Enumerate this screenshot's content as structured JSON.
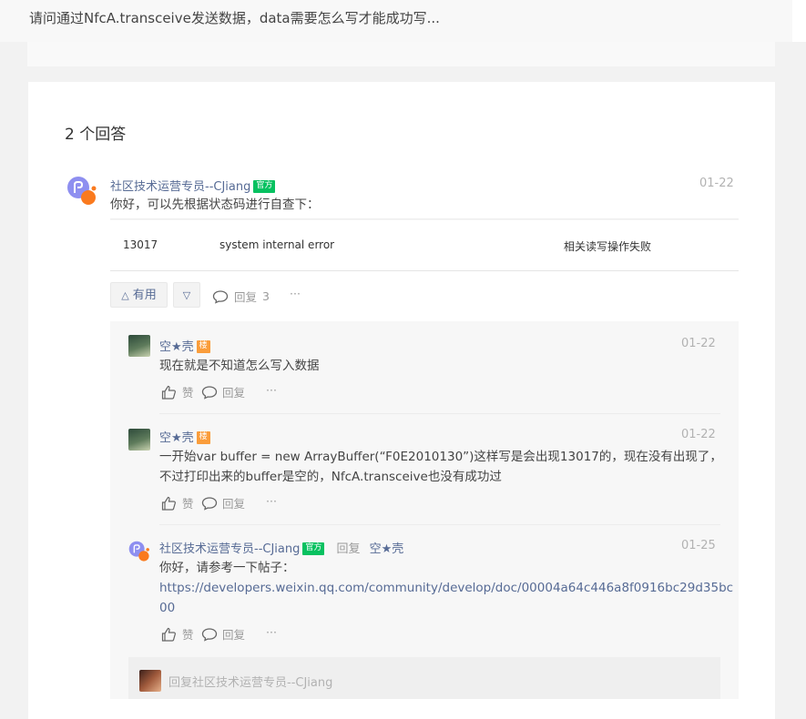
{
  "question": {
    "title": "请问通过NfcA.transceive发送数据，data需要怎么写才能成功写..."
  },
  "answers_title": "2 个回答",
  "answer": {
    "author": "社区技术运营专员--CJiang",
    "badge": "官方",
    "date": "01-22",
    "text": "你好，可以先根据状态码进行自查下：",
    "table": {
      "code": "13017",
      "message": "system internal error",
      "desc": "相关读写操作失败"
    },
    "useful_label": "有用",
    "reply_label": "回复",
    "reply_count": "3",
    "more": "···"
  },
  "comments": [
    {
      "author": "空★壳",
      "badge": "楼",
      "date": "01-22",
      "text": "现在就是不知道怎么写入数据",
      "like": "赞",
      "reply": "回复",
      "more": "···"
    },
    {
      "author": "空★壳",
      "badge": "楼",
      "date": "01-22",
      "text_line1": "一开始var buffer = new ArrayBuffer(“F0E2010130”)这样写是会出现13017的，现在没有出现了，",
      "text_line2": "不过打印出来的buffer是空的，NfcA.transceive也没有成功过",
      "like": "赞",
      "reply": "回复",
      "more": "···"
    },
    {
      "author": "社区技术运营专员--CJiang",
      "badge": "官方",
      "reply_word": "回复",
      "reply_to": "空★壳",
      "date": "01-25",
      "text": "你好，请参考一下帖子：",
      "link_line1": "https://developers.weixin.qq.com/community/develop/doc/00004a64c446a8f0916bc29d35bc",
      "link_line2": "00",
      "like": "赞",
      "reply": "回复",
      "more": "···"
    }
  ],
  "reply_input": {
    "placeholder": "回复社区技术运营专员--CJiang"
  },
  "colors": {
    "link": "#576b95",
    "official": "#07c160",
    "owner": "#fa9d3b"
  }
}
